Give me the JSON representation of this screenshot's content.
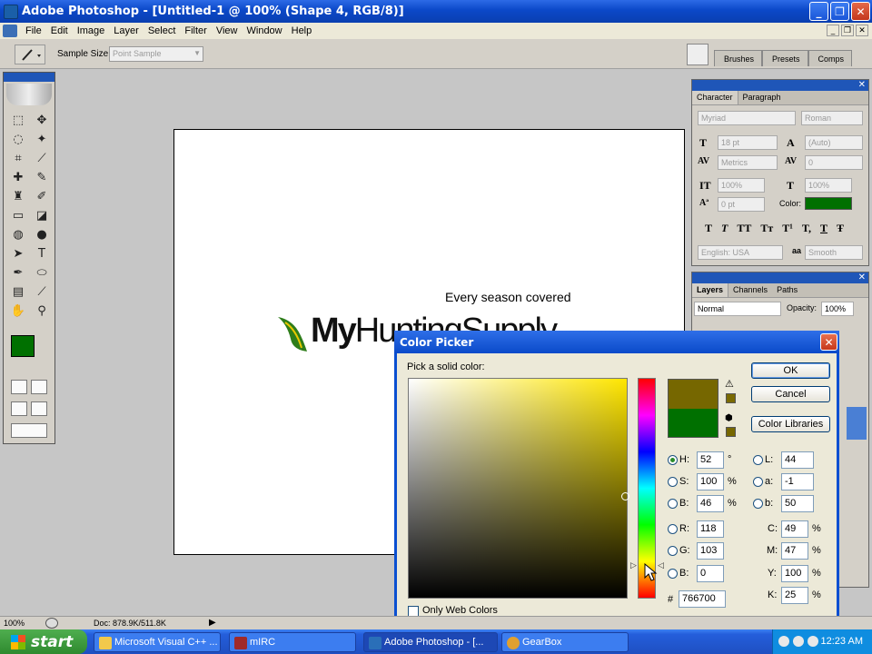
{
  "window": {
    "title": "Adobe Photoshop - [Untitled-1 @ 100% (Shape 4, RGB/8)]",
    "min_glyph": "_",
    "max_glyph": "❐",
    "close_glyph": "✕"
  },
  "menu": {
    "items": [
      "File",
      "Edit",
      "Image",
      "Layer",
      "Select",
      "Filter",
      "View",
      "Window",
      "Help"
    ],
    "doc_min": "_",
    "doc_max": "❐",
    "doc_close": "✕"
  },
  "options": {
    "sample_size_label": "Sample Size:",
    "sample_size_value": "Point Sample"
  },
  "palette_well": {
    "tabs": [
      "Brushes",
      "Presets",
      "Comps"
    ]
  },
  "canvas": {
    "tagline": "Every season covered",
    "logo_my": "My",
    "logo_rest": "HuntingSupply"
  },
  "character_panel": {
    "tabs": [
      "Character",
      "Paragraph"
    ],
    "font_family": "Myriad",
    "font_style": "Roman",
    "size": "18 pt",
    "leading": "(Auto)",
    "kerning": "Metrics",
    "tracking": "0",
    "vscale": "100%",
    "hscale": "100%",
    "baseline": "0 pt",
    "color_label": "Color:",
    "style_buttons": [
      "T",
      "T",
      "TT",
      "Tт",
      "T¹",
      "T,",
      "T",
      "Ŧ"
    ],
    "language": "English: USA",
    "aa_glyph": "aa",
    "antialias": "Smooth"
  },
  "layers_panel": {
    "tabs": [
      "Layers",
      "Channels",
      "Paths"
    ],
    "blend_mode": "Normal",
    "opacity_label": "Opacity:",
    "opacity": "100%"
  },
  "color_picker": {
    "title": "Color Picker",
    "pick_label": "Pick a solid color:",
    "buttons": {
      "ok": "OK",
      "cancel": "Cancel",
      "libraries": "Color Libraries"
    },
    "hsb": [
      {
        "label": "H:",
        "value": "52",
        "unit": "°",
        "selected": true
      },
      {
        "label": "S:",
        "value": "100",
        "unit": "%",
        "selected": false
      },
      {
        "label": "B:",
        "value": "46",
        "unit": "%",
        "selected": false
      }
    ],
    "lab": [
      {
        "label": "L:",
        "value": "44"
      },
      {
        "label": "a:",
        "value": "-1"
      },
      {
        "label": "b:",
        "value": "50"
      }
    ],
    "rgb": [
      {
        "label": "R:",
        "value": "118"
      },
      {
        "label": "G:",
        "value": "103"
      },
      {
        "label": "B:",
        "value": "0"
      }
    ],
    "cmyk": [
      {
        "label": "C:",
        "value": "49",
        "unit": "%"
      },
      {
        "label": "M:",
        "value": "47",
        "unit": "%"
      },
      {
        "label": "Y:",
        "value": "100",
        "unit": "%"
      },
      {
        "label": "K:",
        "value": "25",
        "unit": "%"
      }
    ],
    "hex_label": "#",
    "hex": "766700",
    "only_web_colors": "Only Web Colors",
    "new_color": "#766700",
    "old_color": "#007000"
  },
  "status": {
    "zoom": "100%",
    "doc": "Doc: 878.9K/511.8K"
  },
  "taskbar": {
    "start": "start",
    "tasks": [
      "Microsoft Visual C++ ...",
      "mIRC",
      "Adobe Photoshop - [...",
      "GearBox"
    ],
    "time": "12:23 AM"
  },
  "colors": {
    "foreground": "#007000",
    "background": "#ffffff",
    "titlebar": "#0b48c8"
  }
}
